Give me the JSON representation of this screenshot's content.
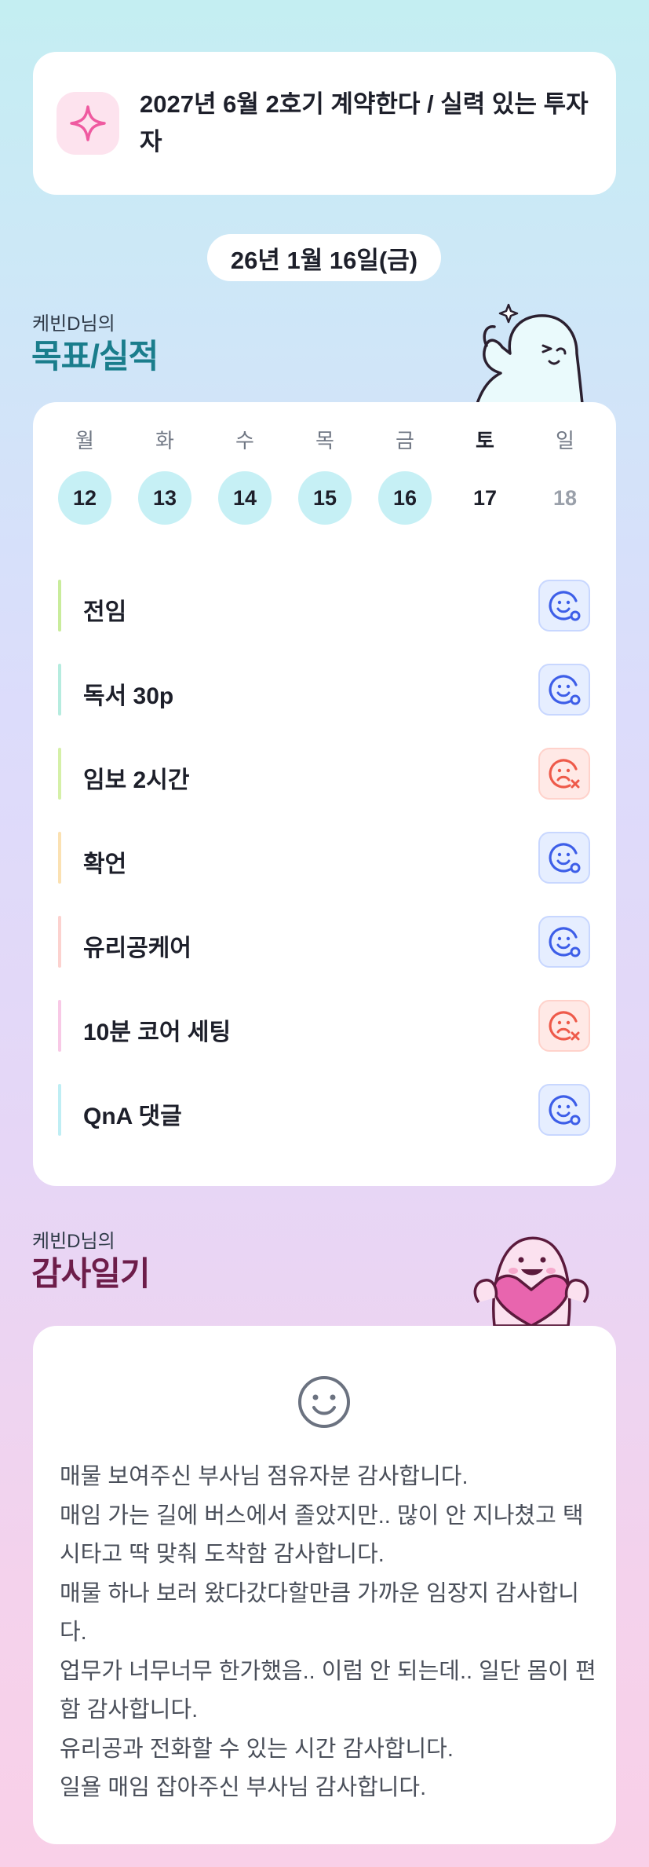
{
  "goal": {
    "icon": "sparkle-icon",
    "text": "2027년 6월 2호기 계약한다 / 실력 있는 투자자"
  },
  "date": "26년 1월 16일(금)",
  "goals_section": {
    "subtitle": "케빈D님의",
    "title": "목표/실적"
  },
  "week": {
    "days": [
      "월",
      "화",
      "수",
      "목",
      "금",
      "토",
      "일"
    ],
    "dates": [
      "12",
      "13",
      "14",
      "15",
      "16",
      "17",
      "18"
    ],
    "filled": [
      true,
      true,
      true,
      true,
      true,
      false,
      false
    ]
  },
  "tasks": [
    {
      "label": "전임",
      "color": "#c9ec9c",
      "status": "done"
    },
    {
      "label": "독서 30p",
      "color": "#b6ecdf",
      "status": "done"
    },
    {
      "label": "임보 2시간",
      "color": "#d5f0a8",
      "status": "missed"
    },
    {
      "label": "확언",
      "color": "#fbe1b2",
      "status": "done"
    },
    {
      "label": "유리공케어",
      "color": "#fcd2cf",
      "status": "done"
    },
    {
      "label": "10분 코어 세팅",
      "color": "#f8c9e6",
      "status": "missed"
    },
    {
      "label": "QnA 댓글",
      "color": "#bfeef4",
      "status": "done"
    }
  ],
  "diary_section": {
    "subtitle": "케빈D님의",
    "title": "감사일기",
    "icon": "smile-icon",
    "lines": [
      "매물 보여주신 부사님 점유자분 감사합니다.",
      "매임 가는 길에 버스에서 졸았지만.. 많이 안 지나쳤고 택시타고 딱 맞춰 도착함 감사합니다.",
      "매물 하나 보러 왔다갔다할만큼 가까운 임장지 감사합니다.",
      "업무가 너무너무 한가했음.. 이럼 안 되는데.. 일단 몸이 편함 감사합니다.",
      "유리공과 전화할 수 있는 시간 감사합니다.",
      "일욜 매임 잡아주신 부사님 감사합니다."
    ]
  },
  "colors": {
    "accent_teal": "#1a7d8c",
    "accent_plum": "#6d1d4a",
    "status_done": "#3d5ee8",
    "status_missed": "#ee5a4a"
  }
}
